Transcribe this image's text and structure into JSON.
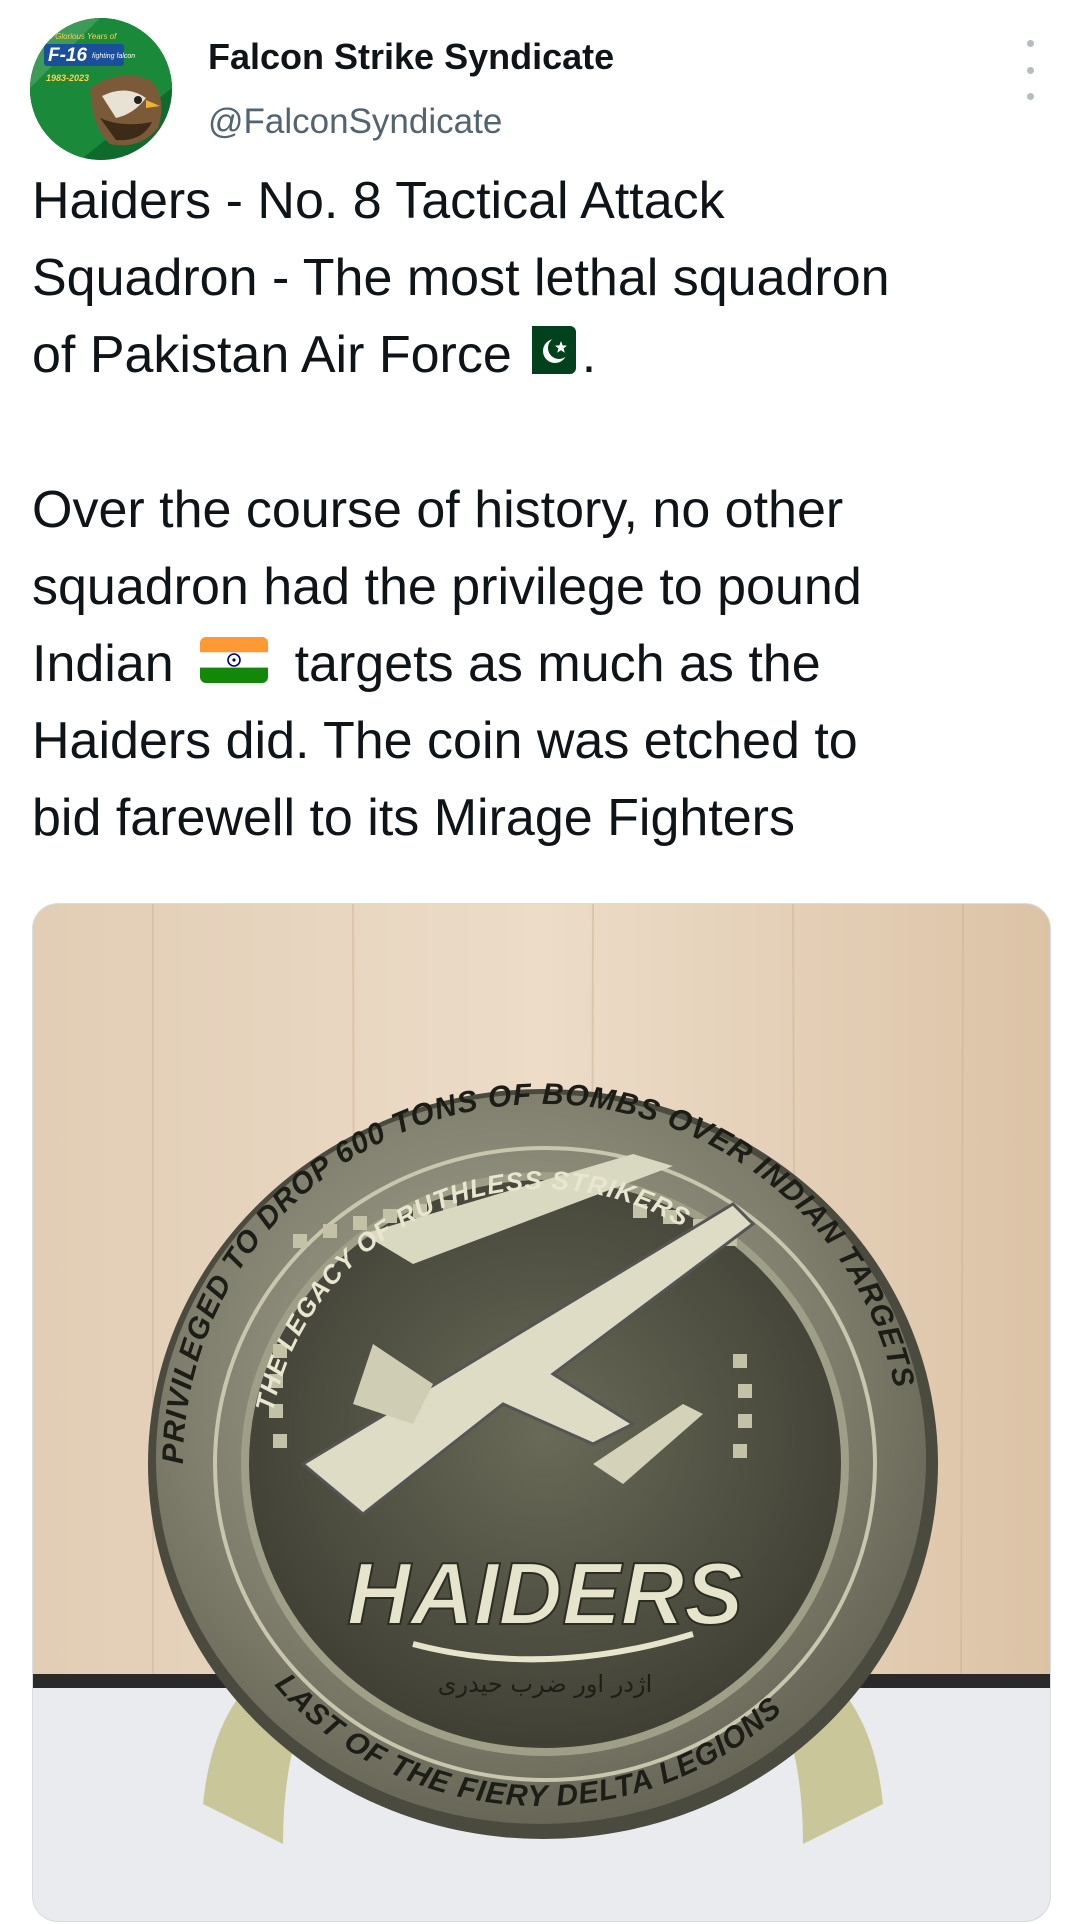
{
  "author": {
    "display_name": "Falcon Strike Syndicate",
    "handle": "@FalconSyndicate",
    "avatar_icon": "f16-falcon-badge-icon",
    "avatar_text": {
      "top": "40 Glorious Years of",
      "model": "F-16",
      "subtitle": "fighting falcon",
      "years": "1983-2023"
    }
  },
  "more_icon": "more-vertical-icon",
  "tweet": {
    "para1_a": "Haiders - No. 8 Tactical Attack",
    "para1_b": "Squadron - The most lethal squadron",
    "para1_c": "of Pakistan Air Force",
    "para1_end": ".",
    "para2_a": "Over the course of history, no other",
    "para2_b": "squadron had the privilege to pound",
    "para2_c1": "Indian",
    "para2_c2": "targets as much as the",
    "para2_d": "Haiders did. The coin was etched to",
    "para2_e": "bid farewell to its Mirage Fighters",
    "flag1_icon": "pakistan-flag-icon",
    "flag2_icon": "india-flag-icon"
  },
  "media": {
    "type": "photo",
    "coin_outer_text": "PRIVILEGED TO DROP 600 TONS OF BOMBS OVER INDIAN TARGETS",
    "coin_inner_text": "THE LEGACY OF RUTHLESS STRIKERS",
    "coin_center_text": "HAIDERS",
    "coin_urdu_text": "اژدر اور ضرب حیدری",
    "coin_bottom_text": "LAST OF THE FIERY DELTA LEGIONS"
  },
  "colors": {
    "handle": "#536471",
    "text": "#0f1419",
    "pak_green": "#01411c",
    "india_saffron": "#ff9933",
    "india_green": "#138808",
    "chakra": "#000080"
  }
}
